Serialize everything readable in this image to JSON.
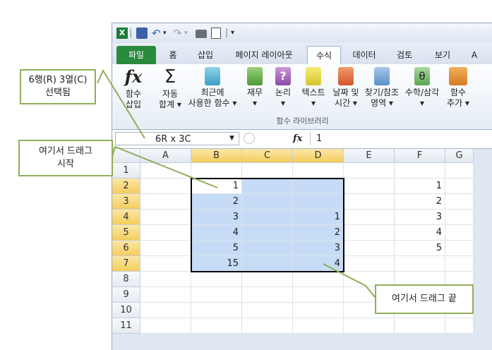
{
  "quick_access": {
    "separator": "|",
    "dropdown_glyph": "▾",
    "excel_logo": "X"
  },
  "tabs": [
    "파일",
    "홈",
    "삽입",
    "페이지 레이아웃",
    "수식",
    "데이터",
    "검토",
    "보기",
    "A"
  ],
  "active_tab": "수식",
  "ribbon": {
    "buttons": [
      {
        "line1": "함수",
        "line2": "삽입",
        "icon": "fx-icon"
      },
      {
        "line1": "자동",
        "line2": "합계 ▾",
        "icon": "sigma-icon"
      },
      {
        "line1": "최근에",
        "line2": "사용한 함수 ▾",
        "icon": "book-star-icon"
      },
      {
        "line1": "재무",
        "line2": "▾",
        "icon": "book-finance-icon"
      },
      {
        "line1": "논리",
        "line2": "▾",
        "icon": "book-question-icon"
      },
      {
        "line1": "텍스트",
        "line2": "▾",
        "icon": "book-text-icon"
      },
      {
        "line1": "날짜 및",
        "line2": "시간 ▾",
        "icon": "book-calendar-icon"
      },
      {
        "line1": "찾기/참조",
        "line2": "영역 ▾",
        "icon": "book-magnifier-icon"
      },
      {
        "line1": "수학/삼각",
        "line2": "▾",
        "icon": "book-theta-icon"
      },
      {
        "line1": "함수",
        "line2": "추가 ▾",
        "icon": "book-more-icon"
      }
    ],
    "group_label": "함수 라이브러리"
  },
  "formula_bar": {
    "name_box": "6R x 3C",
    "fx": "fx",
    "value": "1"
  },
  "columns": [
    "A",
    "B",
    "C",
    "D",
    "E",
    "F",
    "G"
  ],
  "rows": [
    "1",
    "2",
    "3",
    "4",
    "5",
    "6",
    "7",
    "8",
    "9",
    "10",
    "11"
  ],
  "cells": {
    "B2": "1",
    "B3": "2",
    "B4": "3",
    "B5": "4",
    "B6": "5",
    "B7": "15",
    "D4": "1",
    "D5": "2",
    "D6": "3",
    "D7": "4",
    "F2": "1",
    "F3": "2",
    "F4": "3",
    "F5": "4",
    "F6": "5"
  },
  "callouts": {
    "selection": "6행(R) 3열(C)\n선택됨",
    "drag_start": "여기서 드래그\n시작",
    "drag_end": "여기서 드래그 끝"
  },
  "colors": {
    "file_tab": "#2a8a3e",
    "selection_fill": "#c6dcf6",
    "header_highlight": "#f4cd5d",
    "callout_border": "#8fae5a"
  }
}
